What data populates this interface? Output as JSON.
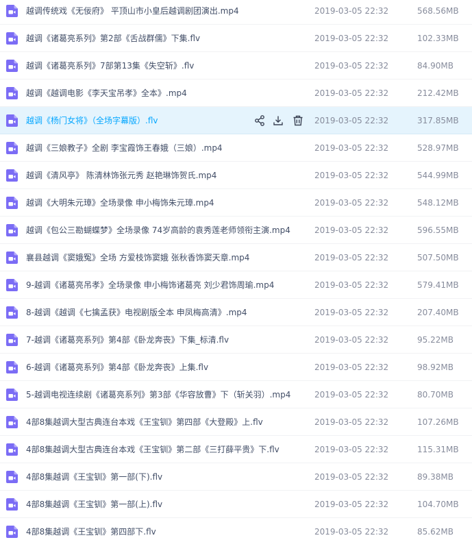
{
  "colors": {
    "video_icon": "#7b6cf5",
    "hover_background": "#e5f4fd",
    "hover_text": "#06a7ff",
    "name_text": "#424e67",
    "meta_text": "#878c9c"
  },
  "icons": {
    "file": "video-file-icon",
    "actions": [
      "share-icon",
      "download-icon",
      "delete-icon"
    ]
  },
  "files": [
    {
      "name": "越调传统戏《无佞府》 平顶山市小皇后越调剧团演出.mp4",
      "date": "2019-03-05 22:32",
      "size": "568.56MB"
    },
    {
      "name": "越调《诸葛亮系列》第2部《舌战群儒》下集.flv",
      "date": "2019-03-05 22:32",
      "size": "102.33MB"
    },
    {
      "name": "越调《诸葛亮系列》7部第13集《失空斩》.flv",
      "date": "2019-03-05 22:32",
      "size": "84.90MB"
    },
    {
      "name": "越调《越调电影《李天宝吊孝》全本》.mp4",
      "date": "2019-03-05 22:32",
      "size": "212.42MB"
    },
    {
      "name": "越调《杨门女将》（全场字幕版）.flv",
      "date": "2019-03-05 22:32",
      "size": "317.85MB",
      "hovered": true
    },
    {
      "name": "越调《三娘教子》全剧 李宝霞饰王春娥（三娘）.mp4",
      "date": "2019-03-05 22:32",
      "size": "528.97MB"
    },
    {
      "name": "越调《清风亭》 陈清林饰张元秀 赵艳琳饰贺氏.mp4",
      "date": "2019-03-05 22:32",
      "size": "544.99MB"
    },
    {
      "name": "越调《大明朱元璋》全场录像 申小梅饰朱元璋.mp4",
      "date": "2019-03-05 22:32",
      "size": "548.12MB"
    },
    {
      "name": "越调《包公三勘蝴蝶梦》全场录像 74岁高龄的袁秀莲老师领衔主演.mp4",
      "date": "2019-03-05 22:32",
      "size": "596.55MB"
    },
    {
      "name": "襄县越调《窦娥冤》全场 方爱枝饰窦娥 张秋香饰窦天章.mp4",
      "date": "2019-03-05 22:32",
      "size": "507.50MB"
    },
    {
      "name": "9-越调《诸葛亮吊孝》全场录像 申小梅饰诸葛亮 刘少君饰周瑜.mp4",
      "date": "2019-03-05 22:32",
      "size": "579.41MB"
    },
    {
      "name": "8-越调《越调《七擒孟获》电视剧版全本 申凤梅高清》.mp4",
      "date": "2019-03-05 22:32",
      "size": "207.40MB"
    },
    {
      "name": "7-越调《诸葛亮系列》第4部《卧龙奔丧》下集_标清.flv",
      "date": "2019-03-05 22:32",
      "size": "95.22MB"
    },
    {
      "name": "6-越调《诸葛亮系列》第4部《卧龙奔丧》上集.flv",
      "date": "2019-03-05 22:32",
      "size": "98.92MB"
    },
    {
      "name": "5-越调电视连续剧《诸葛亮系列》第3部《华容放曹》下（斩关羽）.mp4",
      "date": "2019-03-05 22:32",
      "size": "80.70MB"
    },
    {
      "name": "4部8集越调大型古典连台本戏《王宝钏》第四部《大登殿》上.flv",
      "date": "2019-03-05 22:32",
      "size": "107.26MB"
    },
    {
      "name": "4部8集越调大型古典连台本戏《王宝钏》第二部《三打薛平贵》下.flv",
      "date": "2019-03-05 22:32",
      "size": "115.31MB"
    },
    {
      "name": "4部8集越调《王宝钏》第一部(下).flv",
      "date": "2019-03-05 22:32",
      "size": "89.38MB"
    },
    {
      "name": "4部8集越调《王宝钏》第一部(上).flv",
      "date": "2019-03-05 22:32",
      "size": "104.70MB"
    },
    {
      "name": "4部8集越调《王宝钏》第四部下.flv",
      "date": "2019-03-05 22:32",
      "size": "85.62MB"
    }
  ]
}
